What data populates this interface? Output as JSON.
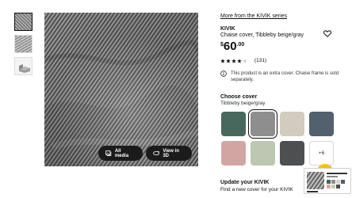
{
  "series_link": "More from the KIVIK series",
  "product": {
    "name": "KIVIK",
    "description": "Chaise cover, Tibbleby beige/gray",
    "price_currency": "$",
    "price_int": "60",
    "price_dec": ".00",
    "rating_stars": 4,
    "rating_max": 5,
    "rating_count": "(131)"
  },
  "info_text": "This product is an extra cover. Chaise frame is sold separately.",
  "media": {
    "all_media_label": "All media",
    "view_3d_label": "View in 3D"
  },
  "cover": {
    "title": "Choose cover",
    "selected_name": "Tibbleby beige/gray",
    "more_label": "+6",
    "swatches": [
      {
        "name": "green",
        "color": "#43665a"
      },
      {
        "name": "tibbleby-beige-gray",
        "color": "#8f8f8f",
        "selected": true
      },
      {
        "name": "beige",
        "color": "#d9d3c5"
      },
      {
        "name": "blue-gray",
        "color": "#4f5d6b"
      },
      {
        "name": "pink",
        "color": "#d8a9a5"
      },
      {
        "name": "light-green",
        "color": "#c3cdb5"
      },
      {
        "name": "dark-gray",
        "color": "#4a4b4d"
      }
    ]
  },
  "update": {
    "title": "Update your KIVIK",
    "subtitle": "Find a new cover for your KIVIK"
  },
  "colors": {
    "accent_yellow": "#f6c300",
    "button_dark": "#1b1b1b"
  }
}
